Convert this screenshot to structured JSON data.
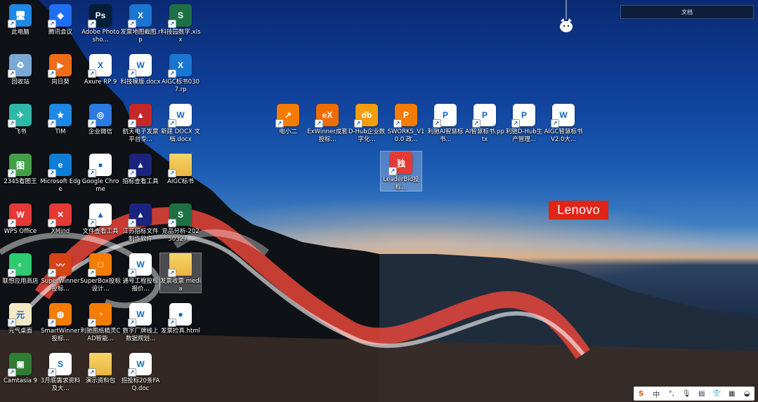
{
  "brand": {
    "logo_text": "Lenovo",
    "logo_color": "#e2231a"
  },
  "search_box": {
    "value": "文档"
  },
  "desktop_icons": [
    {
      "label": "此电脑",
      "icon": "computer-icon",
      "color": "#1e88e5",
      "glyph": "🖥"
    },
    {
      "label": "腾讯会议",
      "icon": "tencent-meeting-icon",
      "color": "#1e6ff5",
      "glyph": "◆"
    },
    {
      "label": "Adobe Photosho...",
      "icon": "photoshop-icon",
      "color": "#001e36",
      "glyph": "Ps"
    },
    {
      "label": "发票地图截图.rp",
      "icon": "axure-file-icon",
      "color": "#1976d2",
      "glyph": "X"
    },
    {
      "label": "科技园数字.xlsx",
      "icon": "excel-file-icon",
      "color": "#1d7044",
      "glyph": "S"
    },
    {
      "label": "回收站",
      "icon": "recycle-bin-icon",
      "color": "#7aa9d6",
      "glyph": "♻"
    },
    {
      "label": "向日葵",
      "icon": "sunlogin-icon",
      "color": "#ef6c1a",
      "glyph": "▶"
    },
    {
      "label": "Axure RP 9",
      "icon": "axure-icon",
      "color": "#ffffff",
      "glyph": "X"
    },
    {
      "label": "科技模版.docx",
      "icon": "word-file-icon",
      "color": "#ffffff",
      "glyph": "W"
    },
    {
      "label": "AIGC标书0307.rp",
      "icon": "axure-file-icon",
      "color": "#1976d2",
      "glyph": "X"
    },
    {
      "label": "飞书",
      "icon": "feishu-icon",
      "color": "#2fb8a8",
      "glyph": "✈"
    },
    {
      "label": "TIM",
      "icon": "tim-icon",
      "color": "#1e88e5",
      "glyph": "★"
    },
    {
      "label": "企业微信",
      "icon": "wecom-icon",
      "color": "#2a7ae2",
      "glyph": "◎"
    },
    {
      "label": "航天电子发票平台专...",
      "icon": "invoice-app-icon",
      "color": "#c62828",
      "glyph": "▲"
    },
    {
      "label": "新建 DOCX 文档.docx",
      "icon": "word-file-icon",
      "color": "#ffffff",
      "glyph": "W"
    },
    {
      "label": "2345看图王",
      "icon": "image-viewer-icon",
      "color": "#43a047",
      "glyph": "图"
    },
    {
      "label": "Microsoft Edge",
      "icon": "edge-icon",
      "color": "#0c7dd8",
      "glyph": "e"
    },
    {
      "label": "Google Chrome",
      "icon": "chrome-icon",
      "color": "#ffffff",
      "glyph": "●"
    },
    {
      "label": "招标查看工具",
      "icon": "tender-tool-icon",
      "color": "#1a237e",
      "glyph": "▲"
    },
    {
      "label": "AIGC标书",
      "icon": "folder-icon",
      "color": "#f4c54a",
      "glyph": ""
    },
    {
      "label": "WPS Office",
      "icon": "wps-icon",
      "color": "#e53935",
      "glyph": "W"
    },
    {
      "label": "XMind",
      "icon": "xmind-icon",
      "color": "#e53935",
      "glyph": "✕"
    },
    {
      "label": "文件查看工具",
      "icon": "file-viewer-icon",
      "color": "#ffffff",
      "glyph": "▲"
    },
    {
      "label": "江苏招标文件制作软件",
      "icon": "tender-maker-icon",
      "color": "#1a237e",
      "glyph": "▲"
    },
    {
      "label": "竞品分析-20250327...",
      "icon": "excel-file-icon",
      "color": "#1d7044",
      "glyph": "S"
    },
    {
      "label": "联想应用商店",
      "icon": "lenovo-store-icon",
      "color": "#2ecc71",
      "glyph": "◐"
    },
    {
      "label": "SuperWinner投标...",
      "icon": "superwinner-icon",
      "color": "#d84315",
      "glyph": "〰"
    },
    {
      "label": "SuperBox投标设计...",
      "icon": "superbox-icon",
      "color": "#f57c00",
      "glyph": "□"
    },
    {
      "label": "通号工程投标报价...",
      "icon": "word-file-icon",
      "color": "#ffffff",
      "glyph": "W"
    },
    {
      "label": "发票收票 media",
      "icon": "folder-icon",
      "color": "#f4c54a",
      "glyph": ""
    },
    {
      "label": "元气桌面",
      "icon": "yuanqi-desktop-icon",
      "color": "#f3e9c6",
      "glyph": "元"
    },
    {
      "label": "SmartWinner投标...",
      "icon": "smartwinner-icon",
      "color": "#f57c00",
      "glyph": "◍"
    },
    {
      "label": "利驰图纸精灵CAD智能...",
      "icon": "cad-icon",
      "color": "#f57c00",
      "glyph": "◔"
    },
    {
      "label": "数字厂牌线上数据规划...",
      "icon": "word-file-icon",
      "color": "#ffffff",
      "glyph": "W"
    },
    {
      "label": "发票捡真.html",
      "icon": "html-file-icon",
      "color": "#ffffff",
      "glyph": "●"
    },
    {
      "label": "Camtasia 9",
      "icon": "camtasia-icon",
      "color": "#2e7d32",
      "glyph": "▣"
    },
    {
      "label": "3月底需求资料及大...",
      "icon": "excel-file-icon",
      "color": "#ffffff",
      "glyph": "S"
    },
    {
      "label": "演示资料包",
      "icon": "folder-icon",
      "color": "#f4c54a",
      "glyph": ""
    },
    {
      "label": "招投标20条FAQ.doc",
      "icon": "word-file-icon",
      "color": "#ffffff",
      "glyph": "W"
    }
  ],
  "center_icons": [
    {
      "label": "电小二",
      "icon": "dianxiaoer-icon",
      "color": "#f57c00",
      "glyph": "↗"
    },
    {
      "label": "ExWinner成套投标...",
      "icon": "exwinner-icon",
      "color": "#ef6c00",
      "glyph": "eX"
    },
    {
      "label": "D-Hub企业数字化...",
      "icon": "dhub-icon",
      "color": "#f59e0b",
      "glyph": "db"
    },
    {
      "label": "SWORKS_V10.0 政...",
      "icon": "sworks-icon",
      "color": "#f57c00",
      "glyph": "P"
    },
    {
      "label": "利驰AI智慧标书...",
      "icon": "ppt-file-icon",
      "color": "#ffffff",
      "glyph": "P"
    },
    {
      "label": "AI智慧标书.pptx",
      "icon": "ppt-file-icon",
      "color": "#ffffff",
      "glyph": "P"
    },
    {
      "label": "利驰D-Hub生产管理...",
      "icon": "ppt-file-icon",
      "color": "#ffffff",
      "glyph": "P"
    },
    {
      "label": "AIGC智慧标书V2.0大...",
      "icon": "word-file-icon",
      "color": "#ffffff",
      "glyph": "W"
    },
    {
      "label": "LeaderBid投标...",
      "icon": "leaderbid-icon",
      "color": "#e53935",
      "glyph": "独"
    }
  ],
  "tray_icons": [
    {
      "name": "sogou-ime-icon",
      "glyph": "S"
    },
    {
      "name": "chinese-mode-label",
      "glyph": "中"
    },
    {
      "name": "punctuation-icon",
      "glyph": "°,"
    },
    {
      "name": "microphone-icon",
      "glyph": "🎙"
    },
    {
      "name": "keyboard-icon",
      "glyph": "▤"
    },
    {
      "name": "skin-icon",
      "glyph": "👕"
    },
    {
      "name": "toolbox-icon",
      "glyph": "▦"
    },
    {
      "name": "more-icon",
      "glyph": "◒"
    }
  ]
}
